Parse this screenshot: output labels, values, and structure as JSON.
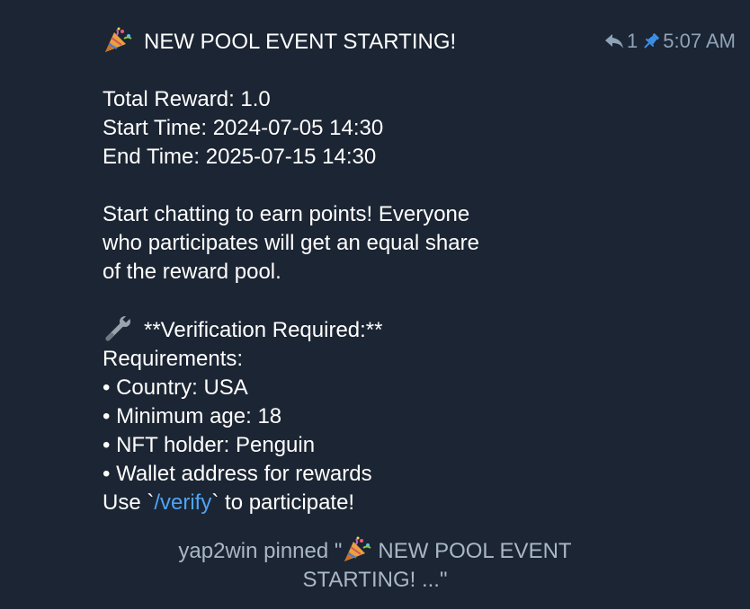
{
  "message": {
    "title": "NEW POOL EVENT STARTING!",
    "title_icon": "party-popper-icon",
    "total_reward": "Total Reward: 1.0",
    "start_time": "Start Time: 2024-07-05 14:30",
    "end_time": "End Time: 2025-07-15 14:30",
    "body_line_1": "Start chatting to earn points! Everyone",
    "body_line_2": "who participates will get an equal share",
    "body_line_3": "of the reward pool.",
    "verification_icon": "wrench-icon",
    "verification_heading": "**Verification Required:**",
    "requirements_label": "Requirements:",
    "requirements": [
      "• Country: USA",
      "• Minimum age: 18",
      "• NFT holder: Penguin",
      "• Wallet address for rewards"
    ],
    "use_prefix": "Use `",
    "verify_command": "/verify",
    "use_suffix": "` to participate!"
  },
  "meta": {
    "reply_count": "1",
    "time": "5:07 AM",
    "reply_icon": "reply-icon",
    "pin_icon": "pin-icon"
  },
  "service": {
    "user": "yap2win",
    "action": " pinned \"",
    "preview_line_1": "NEW POOL EVENT",
    "preview_line_2": "STARTING! ...\""
  },
  "colors": {
    "background": "#1c2533",
    "text": "#ffffff",
    "link": "#4ea4f6",
    "meta": "#8fa3b8",
    "pin": "#3d8fe6",
    "service": "#a9b7c6"
  }
}
